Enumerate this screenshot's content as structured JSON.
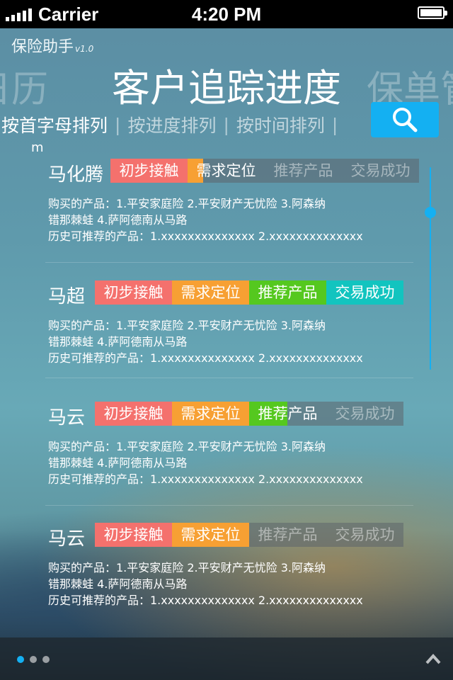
{
  "status_bar": {
    "carrier": "Carrier",
    "time": "4:20 PM"
  },
  "app": {
    "name": "保险助手",
    "version": "v1.0"
  },
  "carousel": {
    "prev": "日历",
    "current": "客户追踪进度",
    "next": "保单管"
  },
  "sort_tabs": [
    {
      "label": "按首字母排列",
      "active": true
    },
    {
      "label": "按进度排列",
      "active": false
    },
    {
      "label": "按时间排列",
      "active": false
    }
  ],
  "index_letter": "m",
  "stage_labels": [
    "初步接触",
    "需求定位",
    "推荐产品",
    "交易成功"
  ],
  "clients": [
    {
      "name": "马化腾",
      "progress_fraction": 0.53,
      "purchased": "购买的产品：1.平安家庭险  2.平安财产无忧险  3.阿森纳",
      "purchased_cont": "错那棘蛙  4.萨阿德南从马路",
      "history": "历史可推荐的产品：1.xxxxxxxxxxxxxx  2.xxxxxxxxxxxxxx"
    },
    {
      "name": "马超",
      "progress_fraction": 1.0,
      "purchased": "购买的产品：1.平安家庭险  2.平安财产无忧险  3.阿森纳",
      "purchased_cont": "错那棘蛙  4.萨阿德南从马路",
      "history": "历史可推荐的产品：1.xxxxxxxxxxxxxx  2.xxxxxxxxxxxxxx"
    },
    {
      "name": "马云",
      "progress_fraction": 0.625,
      "purchased": "购买的产品：1.平安家庭险  2.平安财产无忧险  3.阿森纳",
      "purchased_cont": "错那棘蛙  4.萨阿德南从马路",
      "history": "历史可推荐的产品：1.xxxxxxxxxxxxxx  2.xxxxxxxxxxxxxx"
    },
    {
      "name": "马云",
      "progress_fraction": 0.5,
      "purchased": "购买的产品：1.平安家庭险  2.平安财产无忧险  3.阿森纳",
      "purchased_cont": "错那棘蛙  4.萨阿德南从马路",
      "history": "历史可推荐的产品：1.xxxxxxxxxxxxxx  2.xxxxxxxxxxxxxx"
    }
  ],
  "pager": {
    "count": 3,
    "active_index": 0
  },
  "colors": {
    "accent": "#14b0f2",
    "stage_1": "#f4716d",
    "stage_2": "#f7a033",
    "stage_3": "#55c81f",
    "stage_4": "#12c4bf"
  },
  "icons": {
    "search": "search-icon",
    "up": "chevron-up-icon"
  }
}
